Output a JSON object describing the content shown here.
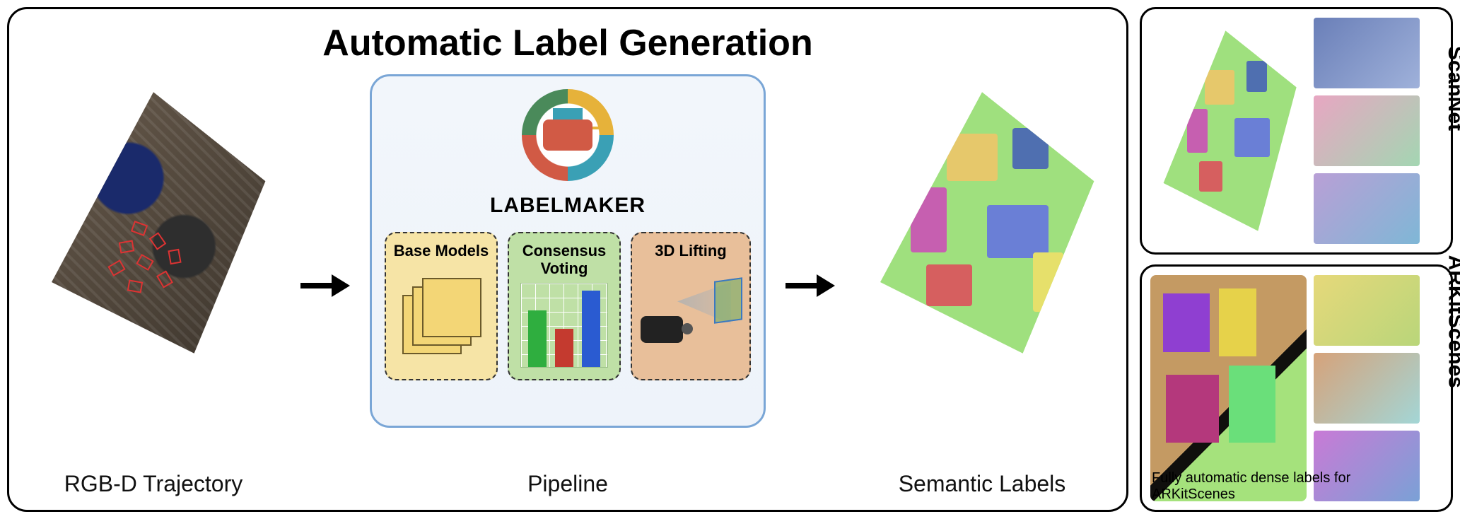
{
  "title": "Automatic Label Generation",
  "input_caption": "RGB-D Trajectory",
  "pipeline_caption": "Pipeline",
  "output_caption": "Semantic Labels",
  "labelmaker_name": "LABELMAKER",
  "module_base": "Base Models",
  "module_consensus": "Consensus Voting",
  "module_lift": "3D Lifting",
  "right_top_title": "ScanNet",
  "right_bottom_title": "ARKitScenes",
  "arkit_subcaption": "Fully automatic dense labels for ARKitScenes"
}
